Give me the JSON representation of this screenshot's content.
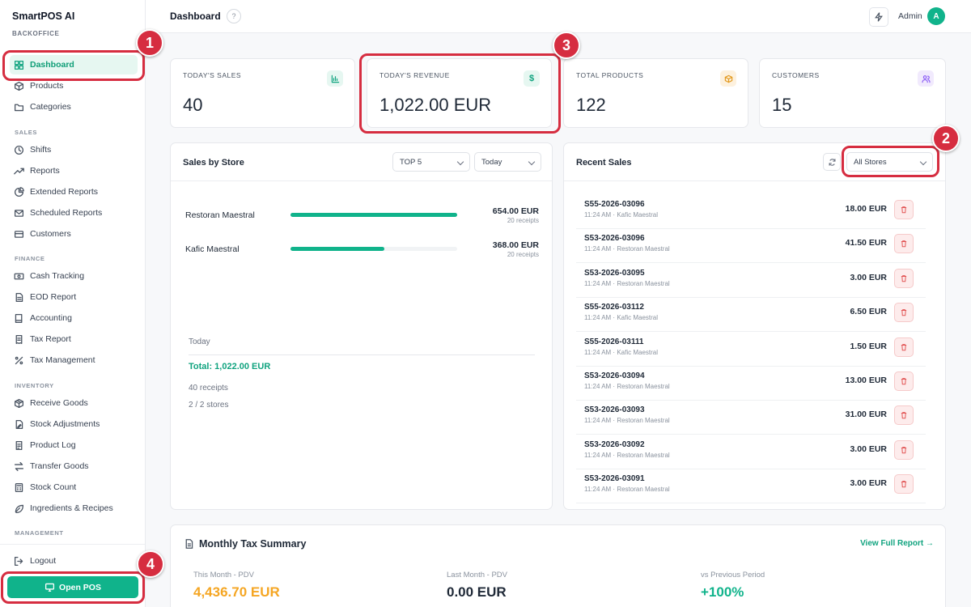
{
  "brand": {
    "name": "SmartPOS AI",
    "subtitle": "BACKOFFICE"
  },
  "sidebar": {
    "items_top": [
      {
        "label": "Dashboard",
        "icon": "grid-icon"
      },
      {
        "label": "Products",
        "icon": "box-icon"
      },
      {
        "label": "Categories",
        "icon": "folder-icon"
      }
    ],
    "sections": {
      "sales": "SALES",
      "finance": "FINANCE",
      "inventory": "INVENTORY",
      "management": "MANAGEMENT"
    },
    "items_sales": [
      {
        "label": "Shifts",
        "icon": "clock-icon"
      },
      {
        "label": "Reports",
        "icon": "trend-icon"
      },
      {
        "label": "Extended Reports",
        "icon": "pie-icon"
      },
      {
        "label": "Scheduled Reports",
        "icon": "mail-icon"
      },
      {
        "label": "Customers",
        "icon": "card-icon"
      }
    ],
    "items_finance": [
      {
        "label": "Cash Tracking",
        "icon": "cash-icon"
      },
      {
        "label": "EOD Report",
        "icon": "doc-icon"
      },
      {
        "label": "Accounting",
        "icon": "book-icon"
      },
      {
        "label": "Tax Report",
        "icon": "receipt-icon"
      },
      {
        "label": "Tax Management",
        "icon": "percent-icon"
      }
    ],
    "items_inventory": [
      {
        "label": "Receive Goods",
        "icon": "package-icon"
      },
      {
        "label": "Stock Adjustments",
        "icon": "edit-doc-icon"
      },
      {
        "label": "Product Log",
        "icon": "log-icon"
      },
      {
        "label": "Transfer Goods",
        "icon": "transfer-icon"
      },
      {
        "label": "Stock Count",
        "icon": "calculator-icon"
      },
      {
        "label": "Ingredients & Recipes",
        "icon": "leaf-icon"
      }
    ],
    "logout": "Logout",
    "open_pos": "Open POS"
  },
  "header": {
    "title": "Dashboard",
    "help": "?",
    "user": "Admin",
    "avatar_letter": "A"
  },
  "stats": [
    {
      "label": "TODAY'S SALES",
      "value": "40",
      "icon": "bar-chart-icon"
    },
    {
      "label": "TODAY'S REVENUE",
      "value": "1,022.00 EUR",
      "icon": "dollar-icon"
    },
    {
      "label": "TOTAL PRODUCTS",
      "value": "122",
      "icon": "cube-icon"
    },
    {
      "label": "CUSTOMERS",
      "value": "15",
      "icon": "users-icon"
    }
  ],
  "sales_by_store": {
    "title": "Sales by Store",
    "filter_top": "TOP 5",
    "filter_period": "Today",
    "stores": [
      {
        "name": "Restoran Maestral",
        "amount": "654.00 EUR",
        "receipts": "20 receipts",
        "share": 1.0
      },
      {
        "name": "Kafic Maestral",
        "amount": "368.00 EUR",
        "receipts": "20 receipts",
        "share": 0.563
      }
    ],
    "summary": {
      "period": "Today",
      "total": "Total: 1,022.00 EUR",
      "receipts": "40 receipts",
      "stores": "2 / 2 stores"
    }
  },
  "recent_sales": {
    "title": "Recent Sales",
    "store_filter": "All Stores",
    "rows": [
      {
        "id": "S55-2026-03096",
        "meta": "11:24 AM · Kafic Maestral",
        "amount": "18.00 EUR"
      },
      {
        "id": "S53-2026-03096",
        "meta": "11:24 AM · Restoran Maestral",
        "amount": "41.50 EUR"
      },
      {
        "id": "S53-2026-03095",
        "meta": "11:24 AM · Restoran Maestral",
        "amount": "3.00 EUR"
      },
      {
        "id": "S55-2026-03112",
        "meta": "11:24 AM · Kafic Maestral",
        "amount": "6.50 EUR"
      },
      {
        "id": "S55-2026-03111",
        "meta": "11:24 AM · Kafic Maestral",
        "amount": "1.50 EUR"
      },
      {
        "id": "S53-2026-03094",
        "meta": "11:24 AM · Restoran Maestral",
        "amount": "13.00 EUR"
      },
      {
        "id": "S53-2026-03093",
        "meta": "11:24 AM · Restoran Maestral",
        "amount": "31.00 EUR"
      },
      {
        "id": "S53-2026-03092",
        "meta": "11:24 AM · Restoran Maestral",
        "amount": "3.00 EUR"
      },
      {
        "id": "S53-2026-03091",
        "meta": "11:24 AM · Restoran Maestral",
        "amount": "3.00 EUR"
      }
    ]
  },
  "tax_summary": {
    "title": "Monthly Tax Summary",
    "link": "View Full Report →",
    "columns": [
      {
        "label": "This Month - PDV",
        "value": "4,436.70 EUR",
        "color": "#f5a623"
      },
      {
        "label": "Last Month - PDV",
        "value": "0.00 EUR",
        "color": "#1f2937"
      },
      {
        "label": "vs Previous Period",
        "value": "+100%",
        "color": "#10b38b"
      }
    ]
  },
  "annotations": [
    "1",
    "2",
    "3",
    "4"
  ],
  "colors": {
    "accent": "#10b38b",
    "annotation": "#d62d40"
  }
}
